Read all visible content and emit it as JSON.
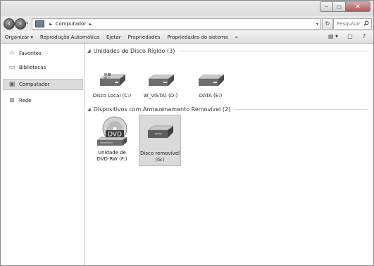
{
  "window": {
    "controls": {
      "minimize": "─",
      "maximize": "□",
      "close": "✕"
    }
  },
  "nav": {
    "back": "‹",
    "forward": "›",
    "dropdown": "▾",
    "address": {
      "separator": "►",
      "location": "Computador",
      "trail_separator": "►"
    },
    "refresh": "↻",
    "search_placeholder": "Pesquisar ...",
    "search_icon": "search-icon"
  },
  "toolbar": {
    "items": [
      "Organizar ▾",
      "Reprodução Automática",
      "Ejetar",
      "Propriedades",
      "Propriedades do sistema",
      "»"
    ],
    "right_icons": [
      "▤ ▾",
      "▢",
      "?"
    ]
  },
  "sidebar": {
    "items": [
      {
        "label": "Favoritos",
        "icon": "star-icon",
        "glyph": "☆"
      },
      {
        "label": "Bibliotecas",
        "icon": "library-icon",
        "glyph": "▭"
      },
      {
        "label": "Computador",
        "icon": "computer-icon",
        "glyph": "▣",
        "selected": true
      },
      {
        "label": "Rede",
        "icon": "network-icon",
        "glyph": "⊞"
      }
    ]
  },
  "groups": [
    {
      "title": "Unidades de Disco Rígido (3)",
      "items": [
        {
          "label": "Disco Local (C:)",
          "icon": "hard-drive-windows-icon"
        },
        {
          "label": "W_VISTA) (D:)",
          "icon": "hard-drive-icon"
        },
        {
          "label": "DATA (E:)",
          "icon": "hard-drive-icon"
        }
      ]
    },
    {
      "title": "Dispositivos com Armazenamento Removível (2)",
      "items": [
        {
          "label_line1": "Unidade de",
          "label_line2": "DVD-RW (F:)",
          "icon": "dvd-drive-icon",
          "disc_text": "DVD"
        },
        {
          "label_line1": "Disco removível",
          "label_line2": "(G:)",
          "icon": "removable-disk-icon",
          "selected": true
        }
      ]
    }
  ],
  "colors": {
    "selection": "#dadada",
    "chrome": "#e9e9e9",
    "close": "#b05a5a"
  }
}
